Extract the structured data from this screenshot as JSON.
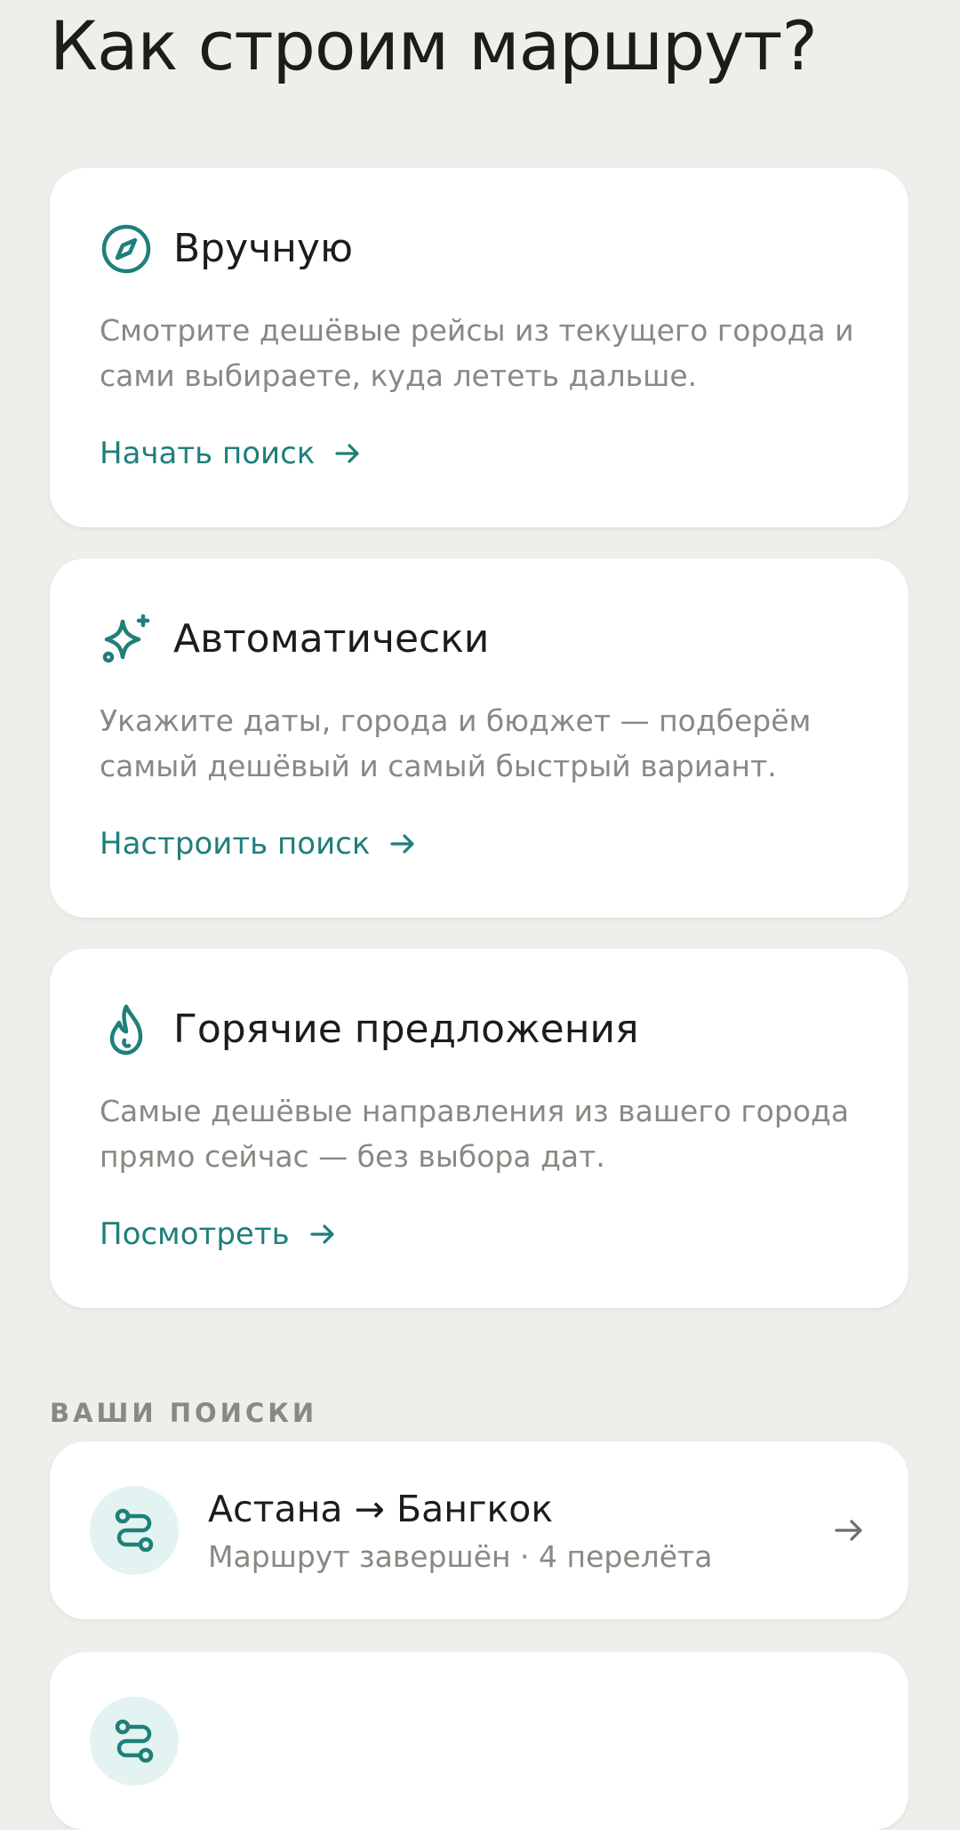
{
  "page": {
    "title": "Как строим маршрут?"
  },
  "options": [
    {
      "icon": "compass-icon",
      "title": "Вручную",
      "description": "Смотрите дешёвые рейсы из текущего города и сами выбираете, куда лететь дальше.",
      "action_label": "Начать поиск"
    },
    {
      "icon": "sparkles-icon",
      "title": "Автоматически",
      "description": "Укажите даты, города и бюджет — подберём самый дешёвый и самый быстрый вариант.",
      "action_label": "Настроить поиск"
    },
    {
      "icon": "flame-icon",
      "title": "Горячие предложения",
      "description": "Самые дешёвые направления из вашего города прямо сейчас — без выбора дат.",
      "action_label": "Посмотреть"
    }
  ],
  "searches": {
    "section_label": "ВАШИ ПОИСКИ",
    "items": [
      {
        "icon": "route-icon",
        "title": "Астана → Бангкок",
        "subtitle": "Маршрут завершён · 4 перелёта"
      },
      {
        "icon": "route-icon",
        "title": "",
        "subtitle": ""
      }
    ]
  },
  "colors": {
    "background": "#efeeeb",
    "card": "#ffffff",
    "accent": "#1f7f7a",
    "text_primary": "#1c1c1a",
    "text_secondary": "#8a8883",
    "avatar_bg": "#e3f3f1"
  }
}
